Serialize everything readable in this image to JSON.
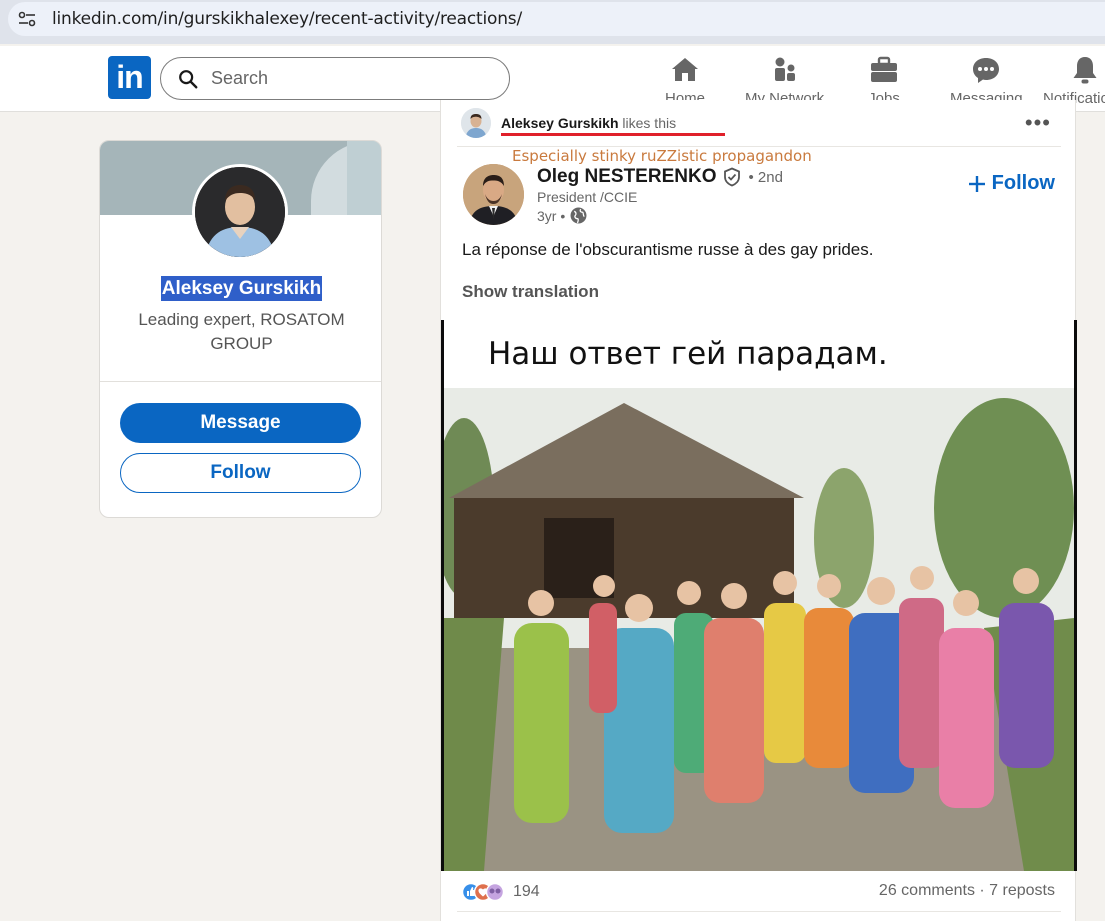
{
  "browser": {
    "url": "linkedin.com/in/gurskikhalexey/recent-activity/reactions/"
  },
  "nav": {
    "logo": "in",
    "search_placeholder": "Search",
    "items": [
      {
        "label": "Home",
        "icon": "home-icon"
      },
      {
        "label": "My Network",
        "icon": "network-icon"
      },
      {
        "label": "Jobs",
        "icon": "briefcase-icon"
      },
      {
        "label": "Messaging",
        "icon": "messaging-icon"
      },
      {
        "label": "Notifications",
        "icon": "bell-icon"
      }
    ]
  },
  "profile": {
    "name": "Aleksey Gurskikh",
    "headline": "Leading expert, ROSATOM GROUP",
    "message_label": "Message",
    "follow_label": "Follow"
  },
  "post": {
    "activity_actor": "Aleksey Gurskikh",
    "activity_verb": "likes this",
    "more": "•••",
    "annotation": "Especially stinky ruZZistic propagandon",
    "author": {
      "name": "Oleg NESTERENKO",
      "degree": "• 2nd",
      "title": "President /CCIE",
      "time": "3yr •"
    },
    "follow_label": "Follow",
    "text": "La réponse de l'obscurantisme russe à des gay prides.",
    "show_translation": "Show translation",
    "image_caption": "Наш ответ гей парадам.",
    "reaction_count": "194",
    "comments_reposts": "26 comments · 7 reposts"
  },
  "colors": {
    "brand": "#0a66c2",
    "highlight": "#2f5fc9",
    "annotation": "#c97a3e",
    "underline": "#e0202a"
  }
}
